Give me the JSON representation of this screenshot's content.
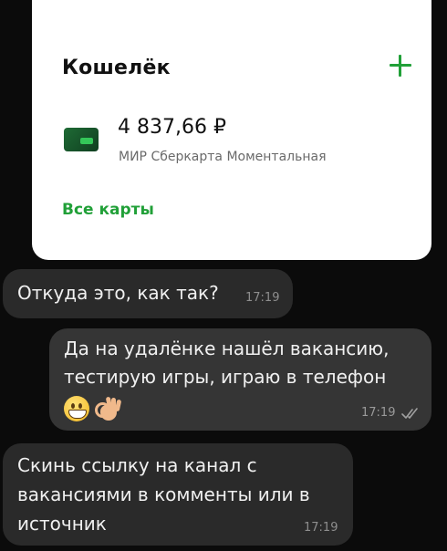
{
  "wallet": {
    "title": "Кошелёк",
    "add_icon": "plus-icon",
    "card": {
      "balance": "4 837,66 ₽",
      "name": "МИР Сберкарта Моментальная",
      "icon": "bank-card-icon"
    },
    "all_cards_label": "Все карты",
    "accent_color": "#21a038"
  },
  "messages": [
    {
      "direction": "incoming",
      "lines": [
        "Откуда это, как так?"
      ],
      "time": "17:19"
    },
    {
      "direction": "outgoing",
      "lines": [
        "Да на удалёнке нашёл вакансию,",
        "тестирую игры, играю в телефон"
      ],
      "emoji": [
        "grinning-face-icon",
        "ok-hand-icon"
      ],
      "time": "17:19",
      "status": "read"
    },
    {
      "direction": "incoming",
      "lines": [
        "Скинь ссылку на канал с",
        "вакансиями в комменты или в",
        "источник"
      ],
      "time": "17:19"
    }
  ]
}
